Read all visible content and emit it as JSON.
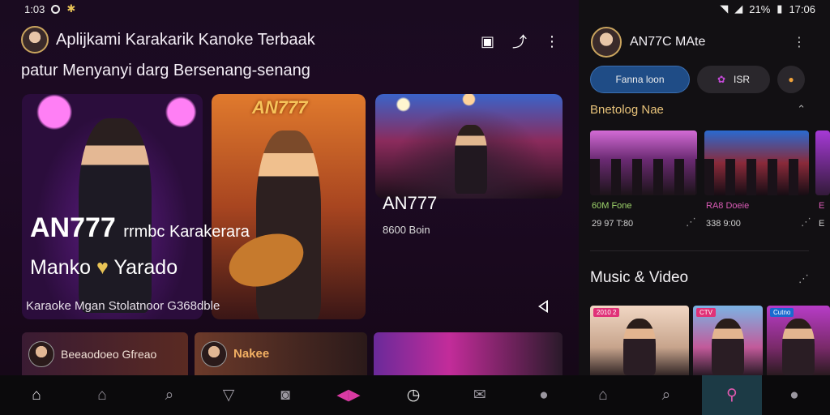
{
  "status_left": {
    "time": "1:03",
    "icons": [
      "circle-icon",
      "sparkle-icon"
    ]
  },
  "status_right": {
    "battery": "21%",
    "time": "17:06"
  },
  "header": {
    "title": "Aplijkami Karakarik Kanoke Terbaak",
    "subtitle": "patur Menyanyi darg Bersenang-senang"
  },
  "hero": {
    "card1_title": "AN777",
    "card1_title_suffix": "rrmbc Karakerara",
    "card1_line2": "Manko",
    "card1_line2_suffix": "Yarado",
    "card2_brand": "AN777",
    "card3_title": "AN777",
    "card3_meta": "8600 Boin",
    "meta": "Karaoke Mgan Stolatnoor G368dble"
  },
  "row2": {
    "a_label": "Beeaodoeo Gfreao",
    "b_label": "Nakee"
  },
  "right": {
    "name": "AN77C MAte",
    "pill_primary": "Fanna loon",
    "pill_secondary": "ISR",
    "section_title": "Bnetolog Nae",
    "cards": [
      {
        "caption": "60M Fone",
        "meta": "29 97 T:80"
      },
      {
        "caption": "RA8 Doeie",
        "meta": "338 9:00"
      },
      {
        "caption": "E",
        "meta": "E"
      }
    ],
    "mv_title": "Music & Video",
    "mv_tags": [
      "2010 2",
      "CTV",
      "Cutno"
    ]
  },
  "nav": {
    "left": [
      "home-icon",
      "house-outline-icon",
      "search-icon",
      "filter-icon",
      "media-icon",
      "karaoke-icon",
      "timer-icon",
      "mail-icon",
      "profile-icon"
    ],
    "right": [
      "home-icon",
      "search-icon",
      "user-search-icon",
      "profile-icon"
    ]
  },
  "colors": {
    "accent": "#d93aa3",
    "primary_pill": "#1f4c86",
    "section_gold": "#e8c37a"
  }
}
